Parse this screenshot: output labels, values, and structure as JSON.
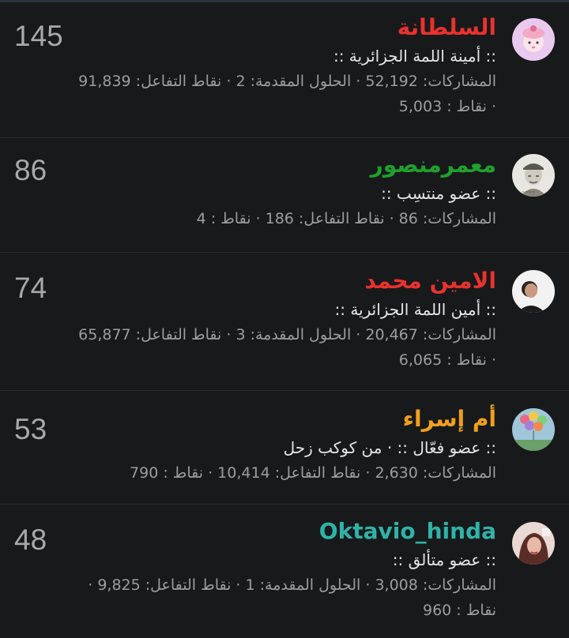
{
  "members": [
    {
      "rank": "145",
      "name": "السلطانة",
      "name_color": "#e8322e",
      "title": ":: أمينة اللمة الجزائرية ::",
      "avatar": "pink-girl-avatar",
      "stats_line1": "المشاركات: 52,192 · الحلول المقدمة: 2 · نقاط التفاعل: 91,839",
      "stats_line2": "· نقاط : 5,003"
    },
    {
      "rank": "86",
      "name": "معمرمنصور",
      "name_color": "#1fa02e",
      "title": ":: عضو منتسِب ::",
      "avatar": "sketch-portrait-avatar",
      "stats_line1": "المشاركات: 86 · نقاط التفاعل: 186 · نقاط : 4",
      "stats_line2": ""
    },
    {
      "rank": "74",
      "name": "الامين محمد",
      "name_color": "#e8322e",
      "title": ":: أمين اللمة الجزائرية ::",
      "avatar": "man-photo-avatar",
      "stats_line1": "المشاركات: 20,467 · الحلول المقدمة: 3 · نقاط التفاعل: 65,877",
      "stats_line2": "· نقاط : 6,065"
    },
    {
      "rank": "53",
      "name": "أم إسراء",
      "name_color": "#f0a01c",
      "title": ":: عضو فعّال :: · من كوكب زحل",
      "avatar": "balloons-avatar",
      "stats_line1": "المشاركات: 2,630 · نقاط التفاعل: 10,414 · نقاط : 790",
      "stats_line2": ""
    },
    {
      "rank": "48",
      "name": "Oktavio_hinda",
      "name_color": "#2fb3a8",
      "title": ":: عضو متألق ::",
      "avatar": "girl-photo-avatar",
      "stats_line1": "المشاركات: 3,008 · الحلول المقدمة: 1 · نقاط التفاعل: 9,825 ·",
      "stats_line2": "نقاط : 960"
    }
  ]
}
